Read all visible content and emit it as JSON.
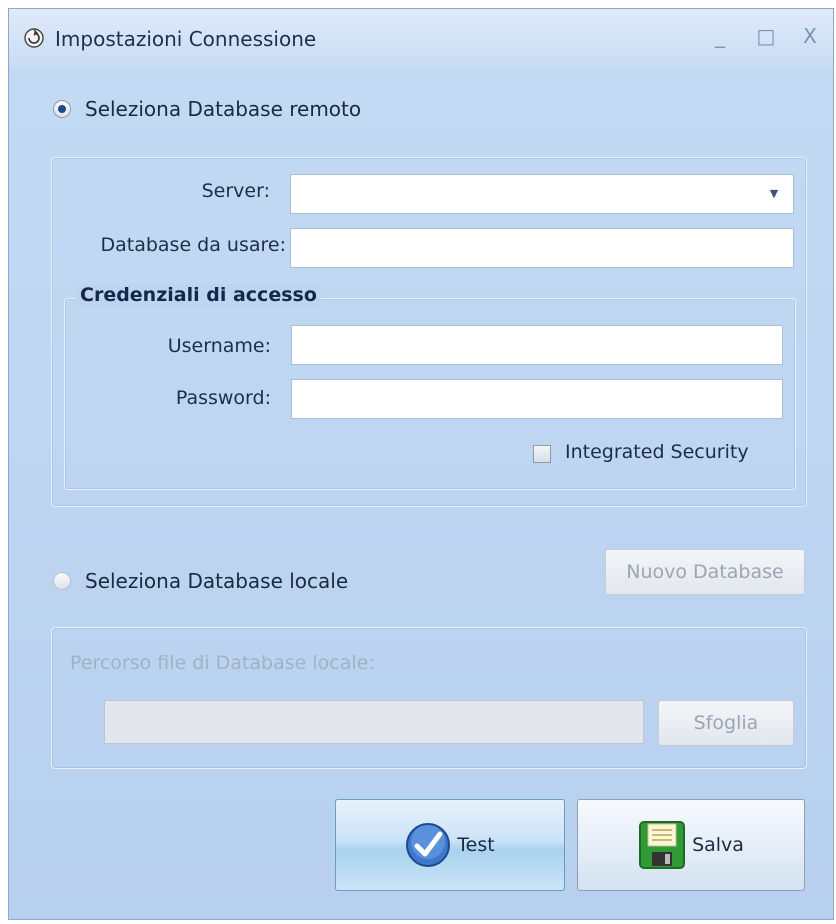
{
  "window": {
    "title": "Impostazioni Connessione",
    "controls": {
      "minimize": "_",
      "maximize": "□",
      "close": "X"
    }
  },
  "remote": {
    "radio_label": "Seleziona Database remoto",
    "selected": true,
    "server": {
      "label": "Server:",
      "value": ""
    },
    "database": {
      "label": "Database da usare:",
      "value": ""
    },
    "credentials": {
      "legend": "Credenziali di accesso",
      "username": {
        "label": "Username:",
        "value": ""
      },
      "password": {
        "label": "Password:",
        "value": ""
      },
      "integrated_security": {
        "label": "Integrated Security",
        "checked": false
      }
    }
  },
  "local": {
    "radio_label": "Seleziona Database locale",
    "selected": false,
    "new_db_button": "Nuovo Database",
    "path_label": "Percorso file di Database locale:",
    "path_value": "",
    "browse_button": "Sfoglia"
  },
  "actions": {
    "test_label": "Test",
    "save_label": "Salva"
  },
  "icons": {
    "app": "app-gear-icon",
    "test": "checkmark-icon",
    "save": "floppy-disk-icon"
  },
  "colors": {
    "accent": "#1d4a8a",
    "window_bg": "#bcd4ef"
  }
}
